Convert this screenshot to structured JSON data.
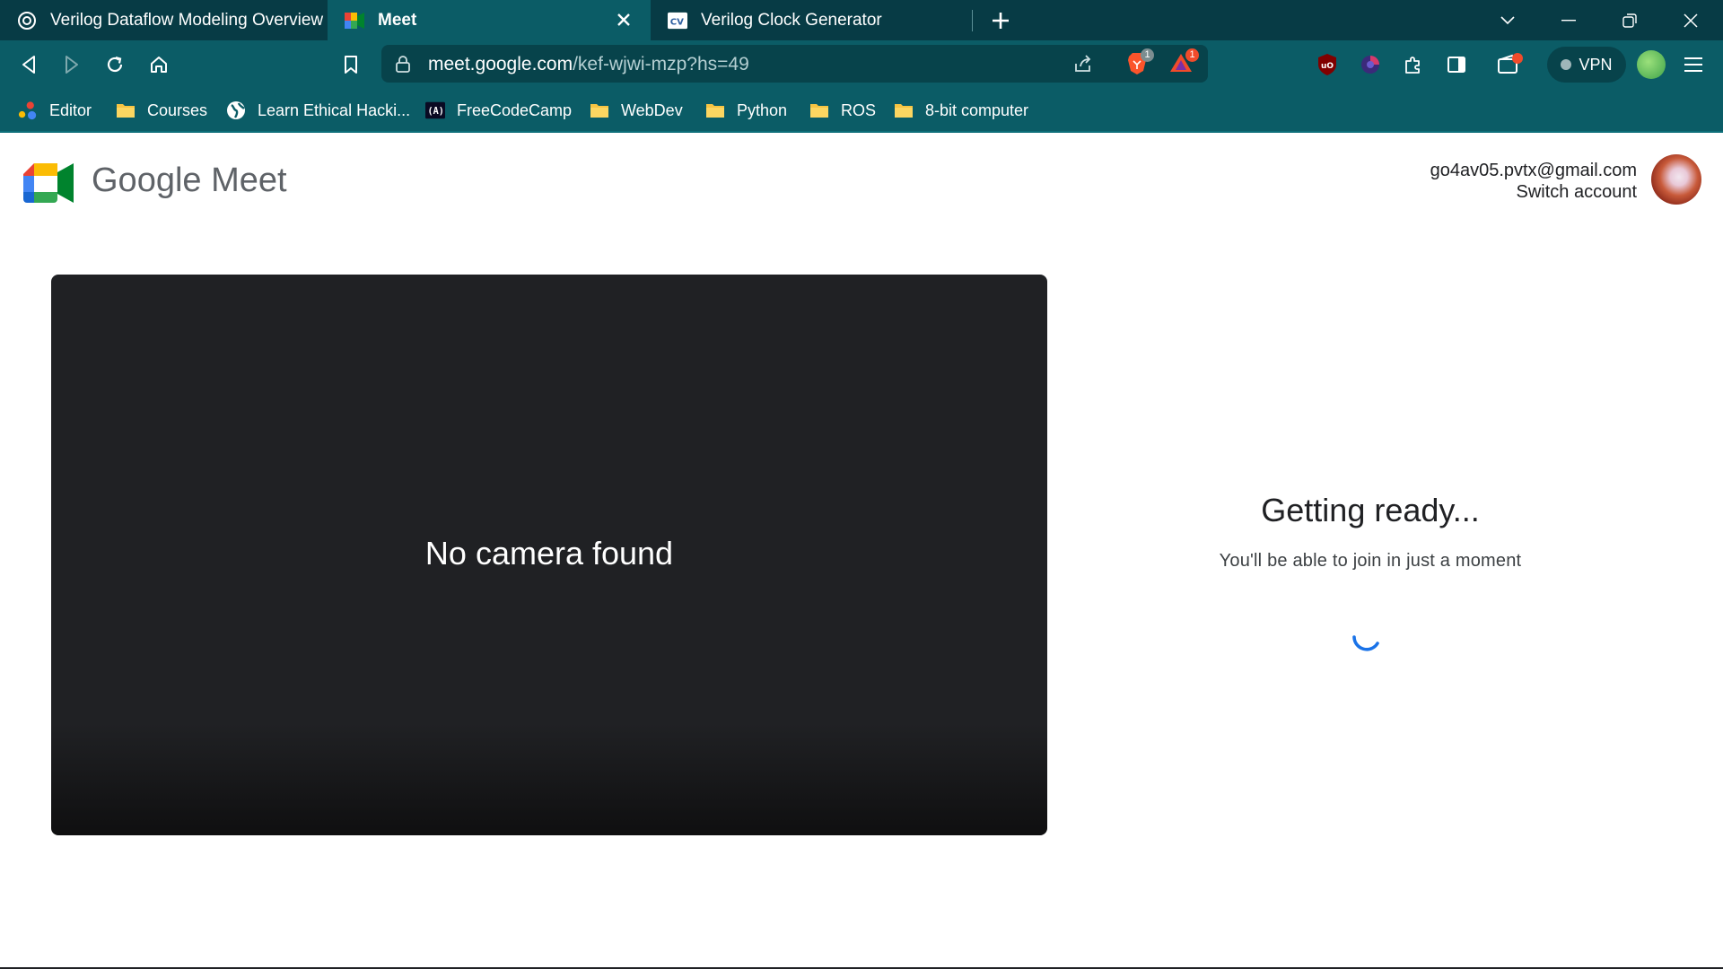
{
  "browser": {
    "tabs": [
      {
        "title": "Verilog Dataflow Modeling Overview",
        "icon": "chatgpt-icon",
        "active": false
      },
      {
        "title": "Meet",
        "icon": "google-meet-icon",
        "active": true
      },
      {
        "title": "Verilog Clock Generator",
        "icon": "cv-icon",
        "active": false
      }
    ],
    "address": {
      "host": "meet.google.com",
      "path": "/kef-wjwi-mzp?hs=49"
    },
    "brave_shields_count": "1",
    "rewards_count": "1",
    "vpn_label": "VPN",
    "bookmarks": [
      {
        "label": "Editor",
        "icon": "google-dots-icon"
      },
      {
        "label": "Courses",
        "icon": "folder-icon"
      },
      {
        "label": "Learn Ethical Hacki...",
        "icon": "globe-icon"
      },
      {
        "label": "FreeCodeCamp",
        "icon": "freecodecamp-icon"
      },
      {
        "label": "WebDev",
        "icon": "folder-icon"
      },
      {
        "label": "Python",
        "icon": "folder-icon"
      },
      {
        "label": "ROS",
        "icon": "folder-icon"
      },
      {
        "label": "8-bit computer",
        "icon": "folder-icon"
      }
    ]
  },
  "meet": {
    "brand": {
      "google": "Google",
      "meet": "Meet"
    },
    "account": {
      "email": "go4av05.pvtx@gmail.com",
      "switch_label": "Switch account"
    },
    "preview_message": "No camera found",
    "status": {
      "title": "Getting ready...",
      "subtitle": "You'll be able to join in just a moment"
    }
  },
  "colors": {
    "chrome_dark": "#073b45",
    "chrome": "#0b5c66",
    "preview_bg": "#202124",
    "spinner": "#1a73e8"
  }
}
